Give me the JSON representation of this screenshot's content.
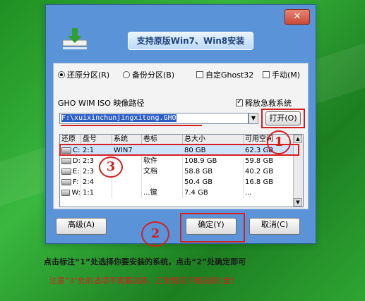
{
  "dialog": {
    "close_label": "✕",
    "banner": "支持原版Win7、Win8安装",
    "colors": {
      "dialog_bg": "#5b93d8",
      "highlight": "#d42020",
      "selection": "#2c5ec8"
    }
  },
  "modes": [
    {
      "label": "还原分区(R)",
      "checked": true,
      "type": "radio"
    },
    {
      "label": "备份分区(B)",
      "checked": false,
      "type": "radio"
    },
    {
      "label": "自定Ghost32",
      "checked": false,
      "type": "checkbox"
    },
    {
      "label": "手动(M)",
      "checked": false,
      "type": "checkbox"
    }
  ],
  "image_path": {
    "label": "GHO WIM ISO 映像路径",
    "value": "F:\\xuixinchunjingxitong.GHO",
    "rescue_label": "释放急救系统",
    "rescue_checked": true,
    "open_button": "打开(O)"
  },
  "table": {
    "columns": [
      "还原",
      "盘号",
      "系统",
      "卷标",
      "总大小",
      "可用空间"
    ],
    "rows": [
      {
        "drive": "C:",
        "disk": "2:1",
        "system": "WIN7",
        "label": "",
        "total": "80 GB",
        "free": "62.3 GB",
        "selected": true
      },
      {
        "drive": "D:",
        "disk": "2:3",
        "system": "",
        "label": "软件",
        "total": "108.9 GB",
        "free": "59.8 GB",
        "selected": false
      },
      {
        "drive": "E:",
        "disk": "2:3",
        "system": "",
        "label": "文档",
        "total": "58.8 GB",
        "free": "40.2 GB",
        "selected": false
      },
      {
        "drive": "F:",
        "disk": "2:4",
        "system": "",
        "label": "",
        "total": "50.4 GB",
        "free": "16.8 GB",
        "selected": false
      },
      {
        "drive": "W:",
        "disk": "1:1",
        "system": "",
        "label": "...键",
        "total": "7.4 GB",
        "free": "...",
        "selected": false
      }
    ]
  },
  "buttons": {
    "advanced": "高级(A)",
    "ok": "确定(Y)",
    "cancel": "取消(C)"
  },
  "annotations": {
    "one": "1",
    "two": "2",
    "three": "3"
  },
  "captions": {
    "line1": "点击标注“1”处选择你要安装的系统，点击“2”处确定即可",
    "line2": "注意“3”处的选项不需要选择，正常情况下都选择C盘！"
  }
}
